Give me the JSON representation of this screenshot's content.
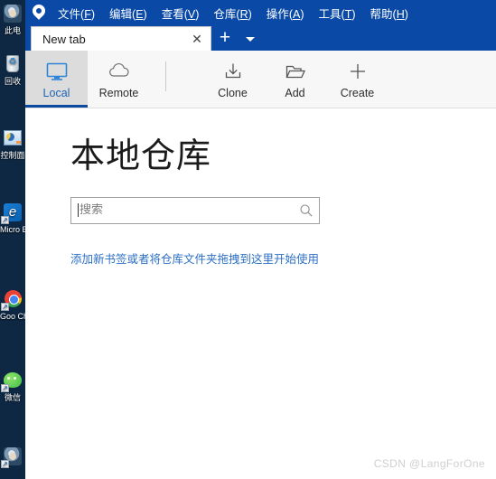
{
  "desktop": {
    "icons": [
      {
        "name": "this-pc",
        "label": "此电",
        "glyph": "ic-app"
      },
      {
        "name": "recycle-bin",
        "label": "回收",
        "glyph": "ic-recycle"
      },
      {
        "name": "control-panel",
        "label": "控制面",
        "glyph": "ic-control"
      },
      {
        "name": "microsoft-edge",
        "label": "Micro Edg",
        "glyph": "ic-edge"
      },
      {
        "name": "google-chrome",
        "label": "Goo Chro",
        "glyph": "ic-chrome"
      },
      {
        "name": "wechat",
        "label": "微信",
        "glyph": "ic-wechat"
      },
      {
        "name": "other-app",
        "label": "",
        "glyph": "ic-app"
      }
    ]
  },
  "window": {
    "accent_color": "#0a4aa6",
    "logo_name": "sourcetree-logo"
  },
  "menubar": {
    "items": [
      {
        "label": "文件",
        "mnemonic": "F"
      },
      {
        "label": "编辑",
        "mnemonic": "E"
      },
      {
        "label": "查看",
        "mnemonic": "V"
      },
      {
        "label": "仓库",
        "mnemonic": "R"
      },
      {
        "label": "操作",
        "mnemonic": "A"
      },
      {
        "label": "工具",
        "mnemonic": "T"
      },
      {
        "label": "帮助",
        "mnemonic": "H"
      }
    ]
  },
  "tabs": {
    "active_tab_label": "New tab",
    "close_glyph": "✕",
    "new_tab_glyph": "+"
  },
  "toolbar": {
    "items": [
      {
        "label": "Local",
        "icon": "monitor-icon",
        "selected": true
      },
      {
        "label": "Remote",
        "icon": "cloud-icon",
        "selected": false
      },
      {
        "label": "Clone",
        "icon": "download-icon",
        "selected": false
      },
      {
        "label": "Add",
        "icon": "folder-open-icon",
        "selected": false
      },
      {
        "label": "Create",
        "icon": "plus-icon",
        "selected": false
      }
    ]
  },
  "main": {
    "title": "本地仓库",
    "search": {
      "value": "",
      "placeholder": "搜索",
      "icon": "search-icon"
    },
    "hint": "添加新书签或者将仓库文件夹拖拽到这里开始使用"
  },
  "watermark": {
    "text": "CSDN @LangForOne"
  }
}
